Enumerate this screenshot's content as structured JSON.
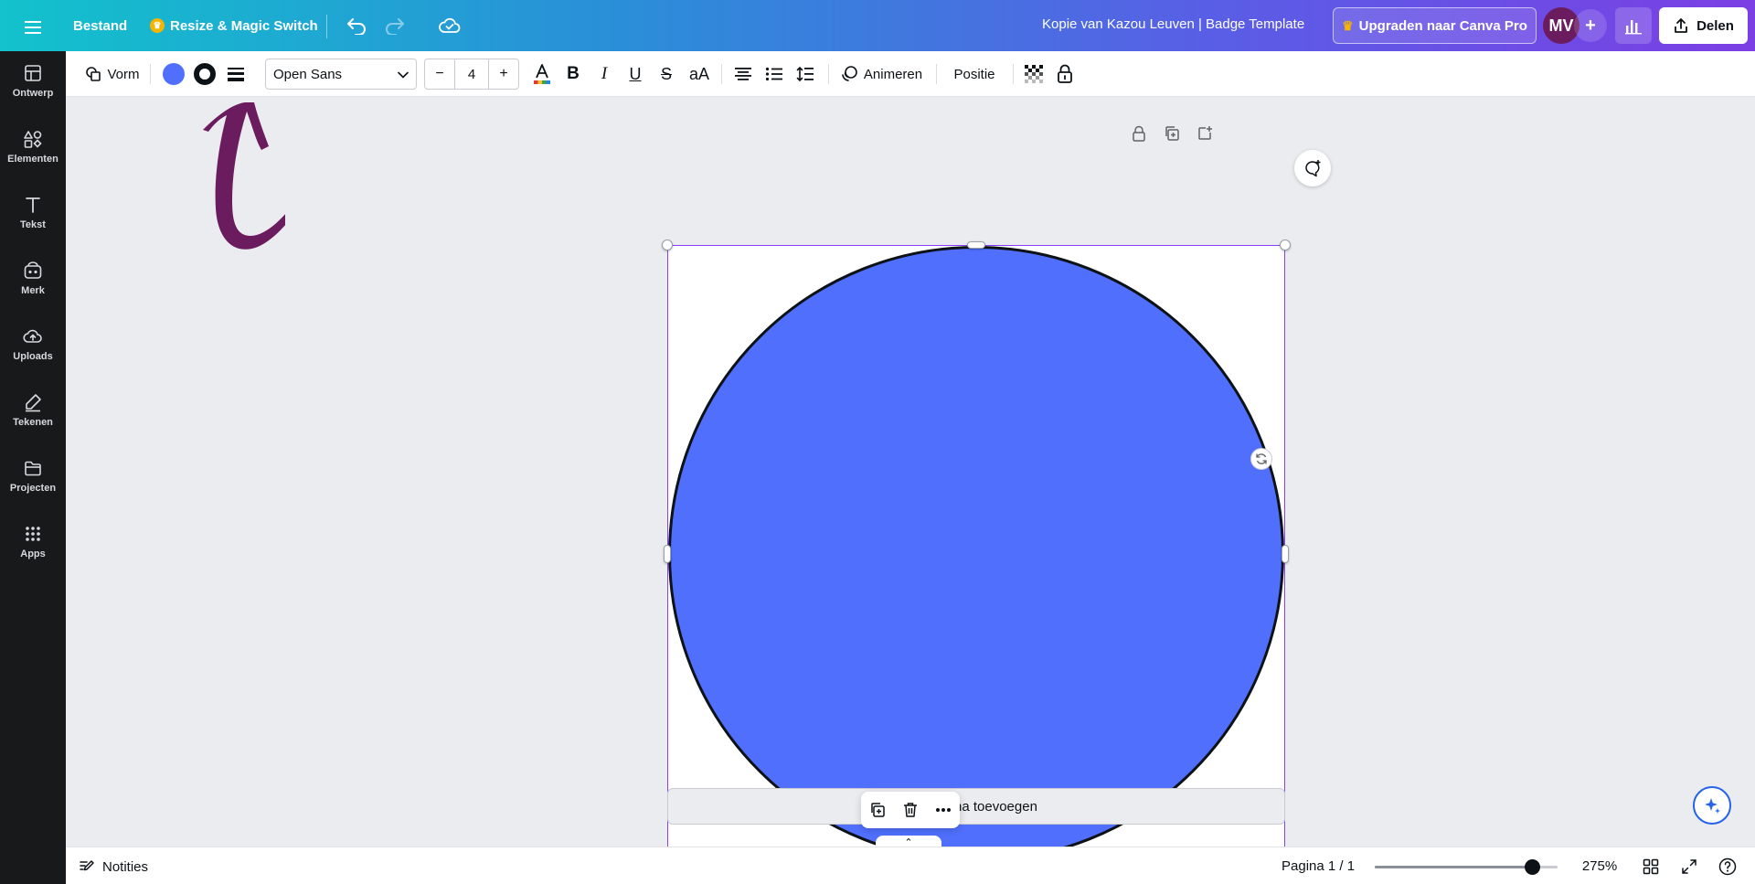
{
  "topbar": {
    "file_label": "Bestand",
    "resize_label": "Resize & Magic Switch",
    "document_title": "Kopie van Kazou Leuven | Badge Template",
    "upgrade_label": "Upgraden naar Canva Pro",
    "avatar_initials": "MV",
    "share_label": "Delen"
  },
  "sidebar": {
    "items": [
      {
        "label": "Ontwerp",
        "icon": "layout-icon"
      },
      {
        "label": "Elementen",
        "icon": "shapes-icon"
      },
      {
        "label": "Tekst",
        "icon": "text-icon"
      },
      {
        "label": "Merk",
        "icon": "brand-icon"
      },
      {
        "label": "Uploads",
        "icon": "upload-cloud-icon"
      },
      {
        "label": "Tekenen",
        "icon": "draw-pen-icon"
      },
      {
        "label": "Projecten",
        "icon": "folder-icon"
      },
      {
        "label": "Apps",
        "icon": "apps-grid-icon"
      }
    ]
  },
  "toolbar": {
    "shape_label": "Vorm",
    "fill_color": "#4f6ffc",
    "font_family": "Open Sans",
    "font_size": "4",
    "animate_label": "Animeren",
    "position_label": "Positie"
  },
  "canvas": {
    "add_page_label": "+ Pagina toevoegen",
    "shape_fill": "#4f6ffc",
    "shape_stroke": "#0d1216",
    "annotation_arrow_color": "#6b1c5e"
  },
  "footer": {
    "notes_label": "Notities",
    "page_indicator": "Pagina 1 / 1",
    "zoom_label": "275%",
    "zoom_fraction": 0.86
  },
  "colors": {
    "accent": "#8b3dff",
    "sidebar_bg": "#18191b",
    "canvas_bg": "#ebecf0"
  }
}
